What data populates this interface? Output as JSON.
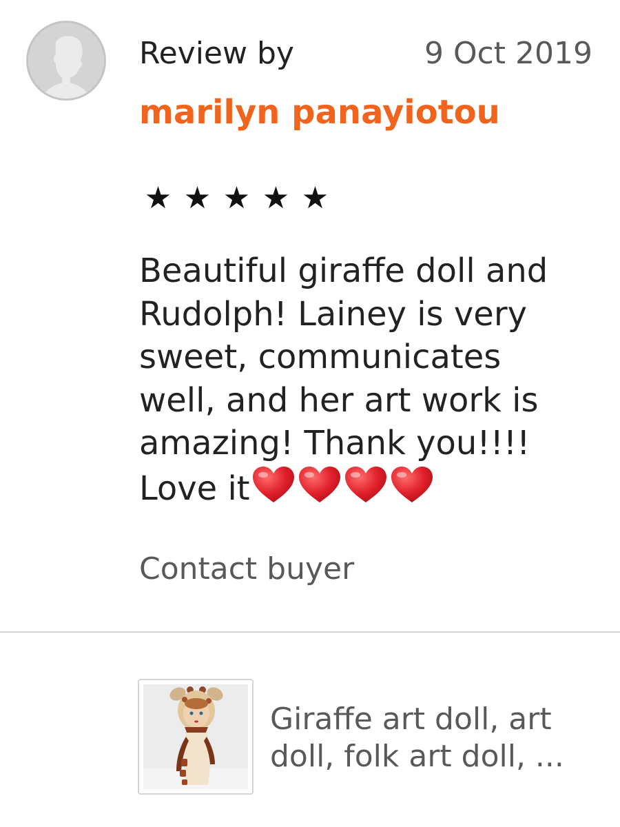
{
  "review": {
    "heading": "Review by",
    "date": "9 Oct 2019",
    "reviewer_name": "marilyn panayiotou",
    "rating": 5,
    "star_glyph": "★",
    "text_lines": [
      "Beautiful giraffe doll and",
      "Rudolph! Lainey is very",
      "sweet, communicates",
      "well, and her art work is",
      "amazing! Thank you!!!!",
      "Love it"
    ],
    "heart_icons": [
      "heart-icon",
      "heart-icon",
      "heart-icon",
      "heart-icon"
    ],
    "contact_label": "Contact buyer"
  },
  "listing": {
    "title_lines": [
      "Giraffe art doll, art",
      "doll, folk art doll, ..."
    ],
    "thumbnail_icon": "giraffe-doll-thumbnail"
  },
  "colors": {
    "reviewer_name": "#f1641e",
    "heart": "#e0202a",
    "secondary_text": "#595959",
    "divider": "#d7d7d7"
  }
}
